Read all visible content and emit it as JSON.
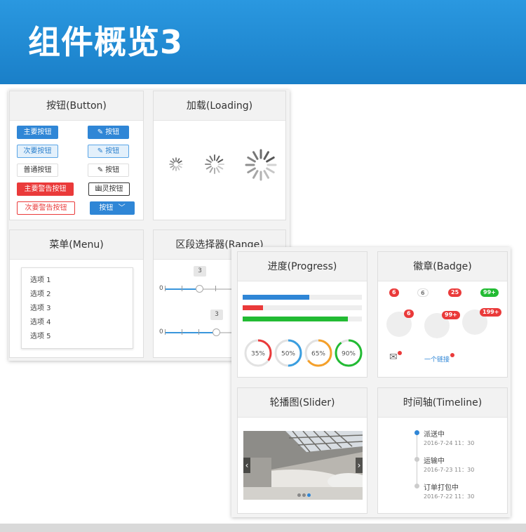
{
  "title": "组件概览3",
  "panels": {
    "button": "按钮(Button)",
    "loading": "加载(Loading)",
    "menu": "菜单(Menu)",
    "range": "区段选择器(Range)",
    "progress": "进度(Progress)",
    "badge": "徽章(Badge)",
    "slider": "轮播图(Slider)",
    "timeline": "时间轴(Timeline)"
  },
  "buttons": {
    "primary": "主要按钮",
    "icon_primary": "按钮",
    "secondary": "次要按钮",
    "icon_secondary": "按钮",
    "default": "普通按钮",
    "icon_default": "按钮",
    "warning": "主要警告按钮",
    "ghost": "幽灵按钮",
    "warning2": "次要警告按钮",
    "dropdown": "按钮"
  },
  "icons": {
    "pencil": "✎",
    "chevron": "﹀",
    "prev": "‹",
    "next": "›",
    "mail": "✉"
  },
  "menu_items": [
    "选项 1",
    "选项 2",
    "选项 3",
    "选项 4",
    "选项 5"
  ],
  "range": {
    "a": {
      "min": "0",
      "tip": "3"
    },
    "b": {
      "min": "0",
      "tip": "3"
    }
  },
  "progress": {
    "bars": [
      {
        "value": 0.56,
        "color": "#2f86d6"
      },
      {
        "value": 0.17,
        "color": "#ea3a3a"
      },
      {
        "value": 0.88,
        "color": "#22bb33"
      }
    ],
    "rings": [
      {
        "label": "35%",
        "value": 0.35,
        "color": "#ea3a3a"
      },
      {
        "label": "50%",
        "value": 0.5,
        "color": "#3a9ee0"
      },
      {
        "label": "65%",
        "value": 0.65,
        "color": "#f5a02a"
      },
      {
        "label": "90%",
        "value": 0.9,
        "color": "#22bb33"
      }
    ]
  },
  "badges": {
    "b1": "6",
    "b2": "6",
    "b3": "25",
    "b4": "99+",
    "c1": "6",
    "c2": "99+",
    "c3": "199+",
    "link": "一个链接"
  },
  "timeline": [
    {
      "title": "派送中",
      "date": "2016-7-24 11：30"
    },
    {
      "title": "运输中",
      "date": "2016-7-23 11：30"
    },
    {
      "title": "订单打包中",
      "date": "2016-7-22 11：30"
    }
  ]
}
